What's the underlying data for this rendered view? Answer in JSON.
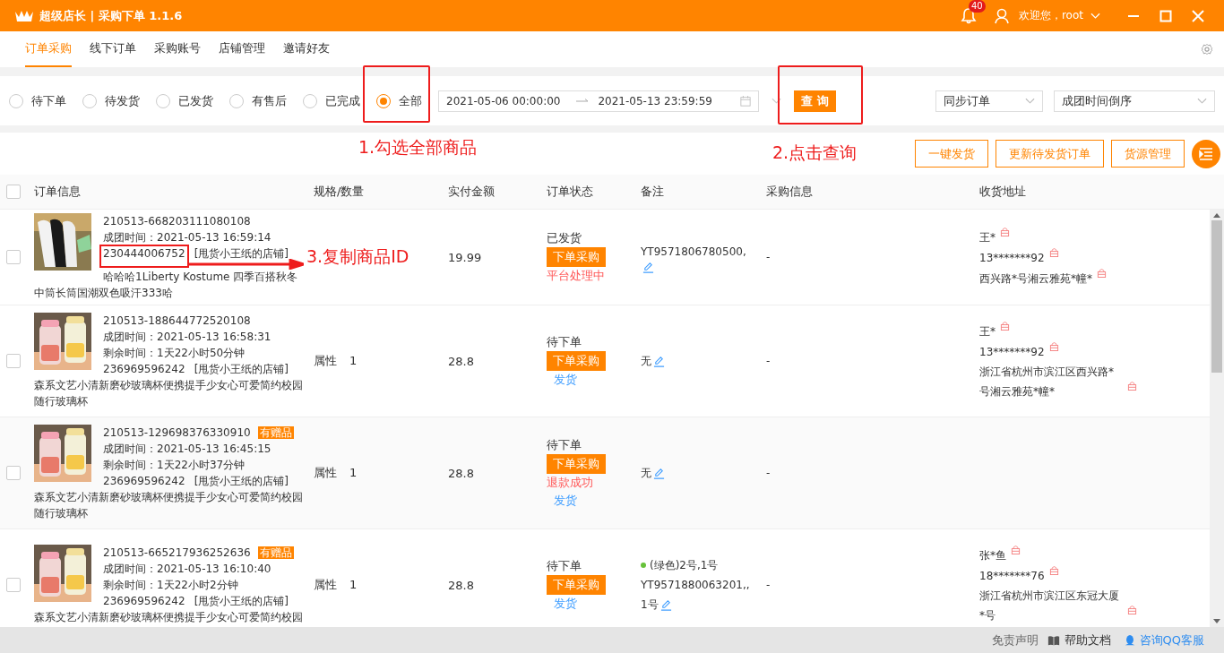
{
  "title_bar": {
    "app_title": "超级店长 | 采购下单 1.1.6",
    "notification_count": "40",
    "user": "欢迎您，root"
  },
  "nav_tabs": [
    {
      "label": "订单采购",
      "selected": true
    },
    {
      "label": "线下订单",
      "selected": false
    },
    {
      "label": "采购账号",
      "selected": false
    },
    {
      "label": "店铺管理",
      "selected": false
    },
    {
      "label": "邀请好友",
      "selected": false
    }
  ],
  "filters": {
    "options": [
      {
        "label": "待下单",
        "selected": false
      },
      {
        "label": "待发货",
        "selected": false
      },
      {
        "label": "已发货",
        "selected": false
      },
      {
        "label": "有售后",
        "selected": false
      },
      {
        "label": "已完成",
        "selected": false
      },
      {
        "label": "全部",
        "selected": true
      }
    ],
    "date_start": "2021-05-06 00:00:00",
    "date_end": "2021-05-13 23:59:59",
    "query_button": "查 询",
    "sync_select": "同步订单",
    "sort_select": "成团时间倒序"
  },
  "actions": [
    "一键发货",
    "更新待发货订单",
    "货源管理"
  ],
  "annotations": [
    "1.勾选全部商品",
    "2.点击查询",
    "3.复制商品ID"
  ],
  "table": {
    "select_all_checked": false,
    "columns": [
      "订单信息",
      "规格/数量",
      "实付金额",
      "订单状态",
      "备注",
      "采购信息",
      "收货地址"
    ],
    "rows": [
      {
        "checked": false,
        "order_no": "210513-668203111080108",
        "gift_tag": null,
        "group_time": "成团时间：2021-05-13 16:59:14",
        "remaining": null,
        "product_id": "230444006752",
        "shop": "[甩货小王纸的店铺]",
        "title": "哈哈哈1Liberty Kostume 四季百搭秋冬中筒长筒国潮双色吸汗333哈",
        "spec": null,
        "qty": null,
        "amount": "19.99",
        "status": "已发货",
        "buy_button": "下单采购",
        "sub_status": [
          {
            "text": "平台处理中",
            "kind": "error"
          }
        ],
        "remark": [
          "YT9571806780500,"
        ],
        "purchase": "-",
        "address": [
          "王*",
          "13*******92",
          "西兴路*号湘云雅苑*幢*"
        ]
      },
      {
        "checked": false,
        "order_no": "210513-188644772520108",
        "gift_tag": null,
        "group_time": "成团时间：2021-05-13 16:58:31",
        "remaining": "剩余时间：1天22小时50分钟",
        "product_id": "236969596242",
        "shop": "[甩货小王纸的店铺]",
        "title": "森系文艺小清新磨砂玻璃杯便携提手少女心可爱简约校园随行玻璃杯",
        "spec": "属性",
        "qty": "1",
        "amount": "28.8",
        "status": "待下单",
        "buy_button": "下单采购",
        "sub_status": [
          {
            "text": "发货",
            "kind": "link"
          }
        ],
        "remark": [
          "无"
        ],
        "purchase": "-",
        "address": [
          "王*",
          "13*******92",
          "浙江省杭州市滨江区西兴路*号湘云雅苑*幢*"
        ]
      },
      {
        "checked": false,
        "order_no": "210513-129698376330910",
        "gift_tag": "有赠品",
        "group_time": "成团时间：2021-05-13 16:45:15",
        "remaining": "剩余时间：1天22小时37分钟",
        "product_id": "236969596242",
        "shop": "[甩货小王纸的店铺]",
        "title": "森系文艺小清新磨砂玻璃杯便携提手少女心可爱简约校园随行玻璃杯",
        "spec": "属性",
        "qty": "1",
        "amount": "28.8",
        "status": "待下单",
        "buy_button": "下单采购",
        "sub_status": [
          {
            "text": "退款成功",
            "kind": "error"
          },
          {
            "text": "发货",
            "kind": "link"
          }
        ],
        "remark": [
          "无"
        ],
        "purchase": "-",
        "address": []
      },
      {
        "checked": false,
        "order_no": "210513-665217936252636",
        "gift_tag": "有赠品",
        "group_time": "成团时间：2021-05-13 16:10:40",
        "remaining": "剩余时间：1天22小时2分钟",
        "product_id": "236969596242",
        "shop": "[甩货小王纸的店铺]",
        "title": "森系文艺小清新磨砂玻璃杯便携提手少女心可爱简约校园",
        "spec": "属性",
        "qty": "1",
        "amount": "28.8",
        "status": "待下单",
        "buy_button": "下单采购",
        "sub_status": [
          {
            "text": "发货",
            "kind": "link"
          }
        ],
        "color": "#67c23a",
        "remark": [
          "(绿色)2号,1号",
          "YT9571880063201,,",
          "1号"
        ],
        "purchase": "-",
        "address": [
          "张*鱼",
          "18*******76",
          "浙江省杭州市滨江区东冠大厦*号"
        ]
      }
    ]
  },
  "footer": {
    "disclaimer": "免责声明",
    "help": "帮助文档",
    "support": "咨询QQ客服"
  }
}
